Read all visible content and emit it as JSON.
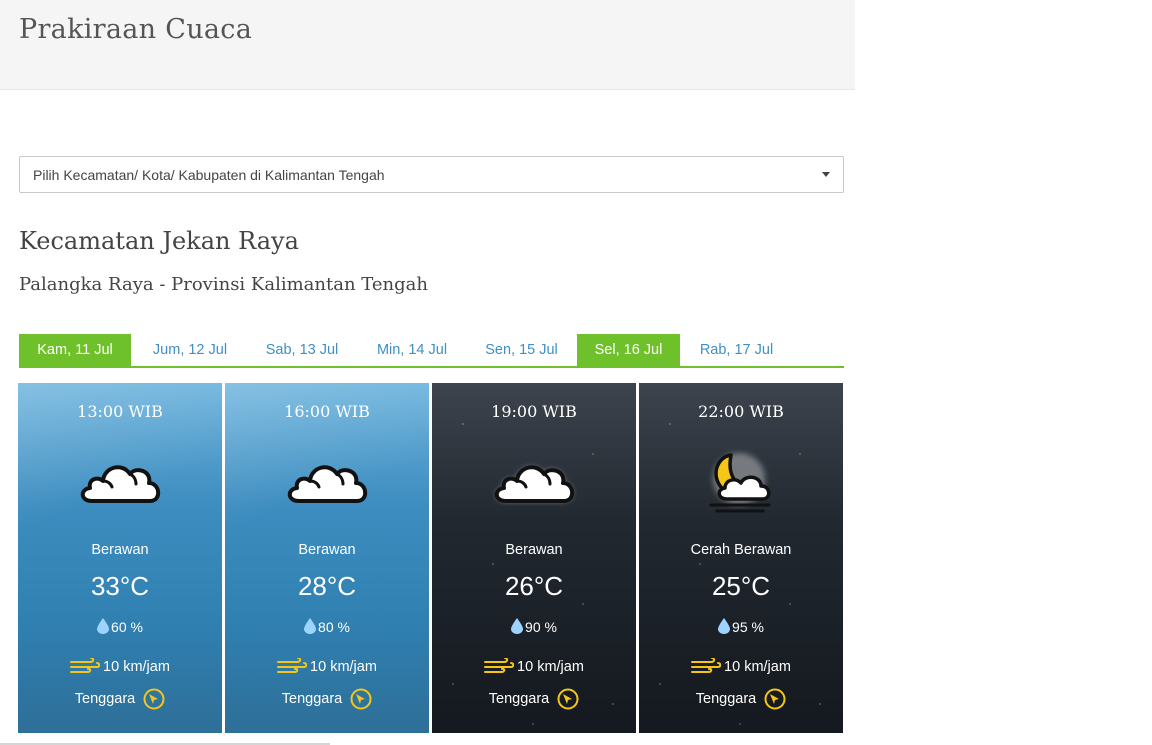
{
  "header": {
    "title": "Prakiraan Cuaca"
  },
  "location_select": {
    "placeholder": "Pilih Kecamatan/ Kota/ Kabupaten di Kalimantan Tengah"
  },
  "location": {
    "title": "Kecamatan Jekan Raya",
    "subtitle": "Palangka Raya - Provinsi Kalimantan Tengah"
  },
  "tabs": [
    {
      "label": "Kam, 11 Jul",
      "active": true
    },
    {
      "label": "Jum, 12 Jul",
      "active": false
    },
    {
      "label": "Sab, 13 Jul",
      "active": false
    },
    {
      "label": "Min, 14 Jul",
      "active": false
    },
    {
      "label": "Sen, 15 Jul",
      "active": false
    },
    {
      "label": "Sel, 16 Jul",
      "active": true
    },
    {
      "label": "Rab, 17 Jul",
      "active": false
    }
  ],
  "forecasts": [
    {
      "time": "13:00 WIB",
      "icon": "cloudy-icon",
      "description": "Berawan",
      "temperature": "33°C",
      "humidity": "60 %",
      "wind_speed": "10 km/jam",
      "wind_direction": "Tenggara",
      "theme": "day"
    },
    {
      "time": "16:00 WIB",
      "icon": "cloudy-icon",
      "description": "Berawan",
      "temperature": "28°C",
      "humidity": "80 %",
      "wind_speed": "10 km/jam",
      "wind_direction": "Tenggara",
      "theme": "day"
    },
    {
      "time": "19:00 WIB",
      "icon": "cloudy-icon",
      "description": "Berawan",
      "temperature": "26°C",
      "humidity": "90 %",
      "wind_speed": "10 km/jam",
      "wind_direction": "Tenggara",
      "theme": "night"
    },
    {
      "time": "22:00 WIB",
      "icon": "partly-cloudy-night-icon",
      "description": "Cerah Berawan",
      "temperature": "25°C",
      "humidity": "95 %",
      "wind_speed": "10 km/jam",
      "wind_direction": "Tenggara",
      "theme": "night"
    }
  ],
  "colors": {
    "accent_green": "#6ec12a",
    "tab_link_blue": "#3f8fc6",
    "day_card": "#3d8dc0",
    "night_card": "#1c2128",
    "icon_yellow": "#f5c518"
  }
}
